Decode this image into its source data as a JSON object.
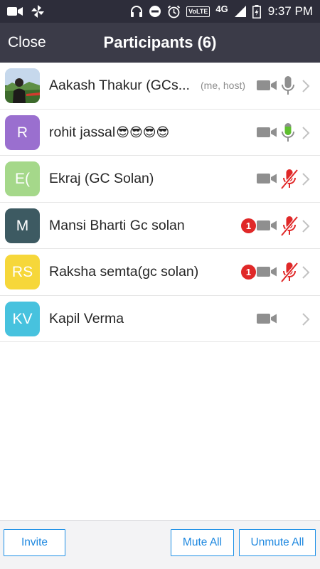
{
  "status_bar": {
    "network": "4G",
    "volte": "VoLTE",
    "time": "9:37 PM"
  },
  "header": {
    "close_label": "Close",
    "title": "Participants (6)"
  },
  "participants": [
    {
      "name": "Aakash Thakur (GCs...",
      "tag": "(me, host)",
      "avatar_initials": "",
      "avatar_color": "",
      "video_icon": "video-camera-icon",
      "audio_icon": "microphone-icon",
      "audio_state": "unmuted",
      "unread": ""
    },
    {
      "name": "rohit jassal",
      "emojis": "😎😎😎😎",
      "tag": "",
      "avatar_initials": "R",
      "avatar_color": "#9a6fcf",
      "video_icon": "video-camera-icon",
      "audio_icon": "microphone-icon",
      "audio_state": "speaking",
      "unread": ""
    },
    {
      "name": "Ekraj (GC Solan)",
      "tag": "",
      "avatar_initials": "E(",
      "avatar_color": "#a5d88a",
      "video_icon": "video-camera-icon",
      "audio_icon": "microphone-muted-icon",
      "audio_state": "muted",
      "unread": ""
    },
    {
      "name": "Mansi Bharti Gc  solan",
      "tag": "",
      "avatar_initials": "M",
      "avatar_color": "#3d5a62",
      "video_icon": "video-camera-icon",
      "audio_icon": "microphone-muted-icon",
      "audio_state": "muted",
      "unread": "1"
    },
    {
      "name": "Raksha semta(gc solan)",
      "tag": "",
      "avatar_initials": "RS",
      "avatar_color": "#f6d73a",
      "video_icon": "video-camera-icon",
      "audio_icon": "microphone-muted-icon",
      "audio_state": "muted",
      "unread": "1"
    },
    {
      "name": "Kapil Verma",
      "tag": "",
      "avatar_initials": "KV",
      "avatar_color": "#47c2de",
      "video_icon": "video-camera-icon",
      "audio_icon": "",
      "audio_state": "none",
      "unread": ""
    }
  ],
  "toolbar": {
    "invite_label": "Invite",
    "mute_all_label": "Mute All",
    "unmute_all_label": "Unmute All"
  },
  "colors": {
    "status_bar_bg": "#2d2d3a",
    "header_bg": "#3b3b48",
    "muted_red": "#e02828",
    "speaking_green": "#5fbf2f",
    "icon_gray": "#8f8f8f",
    "button_blue": "#1e88e0",
    "badge_red": "#e02828"
  }
}
